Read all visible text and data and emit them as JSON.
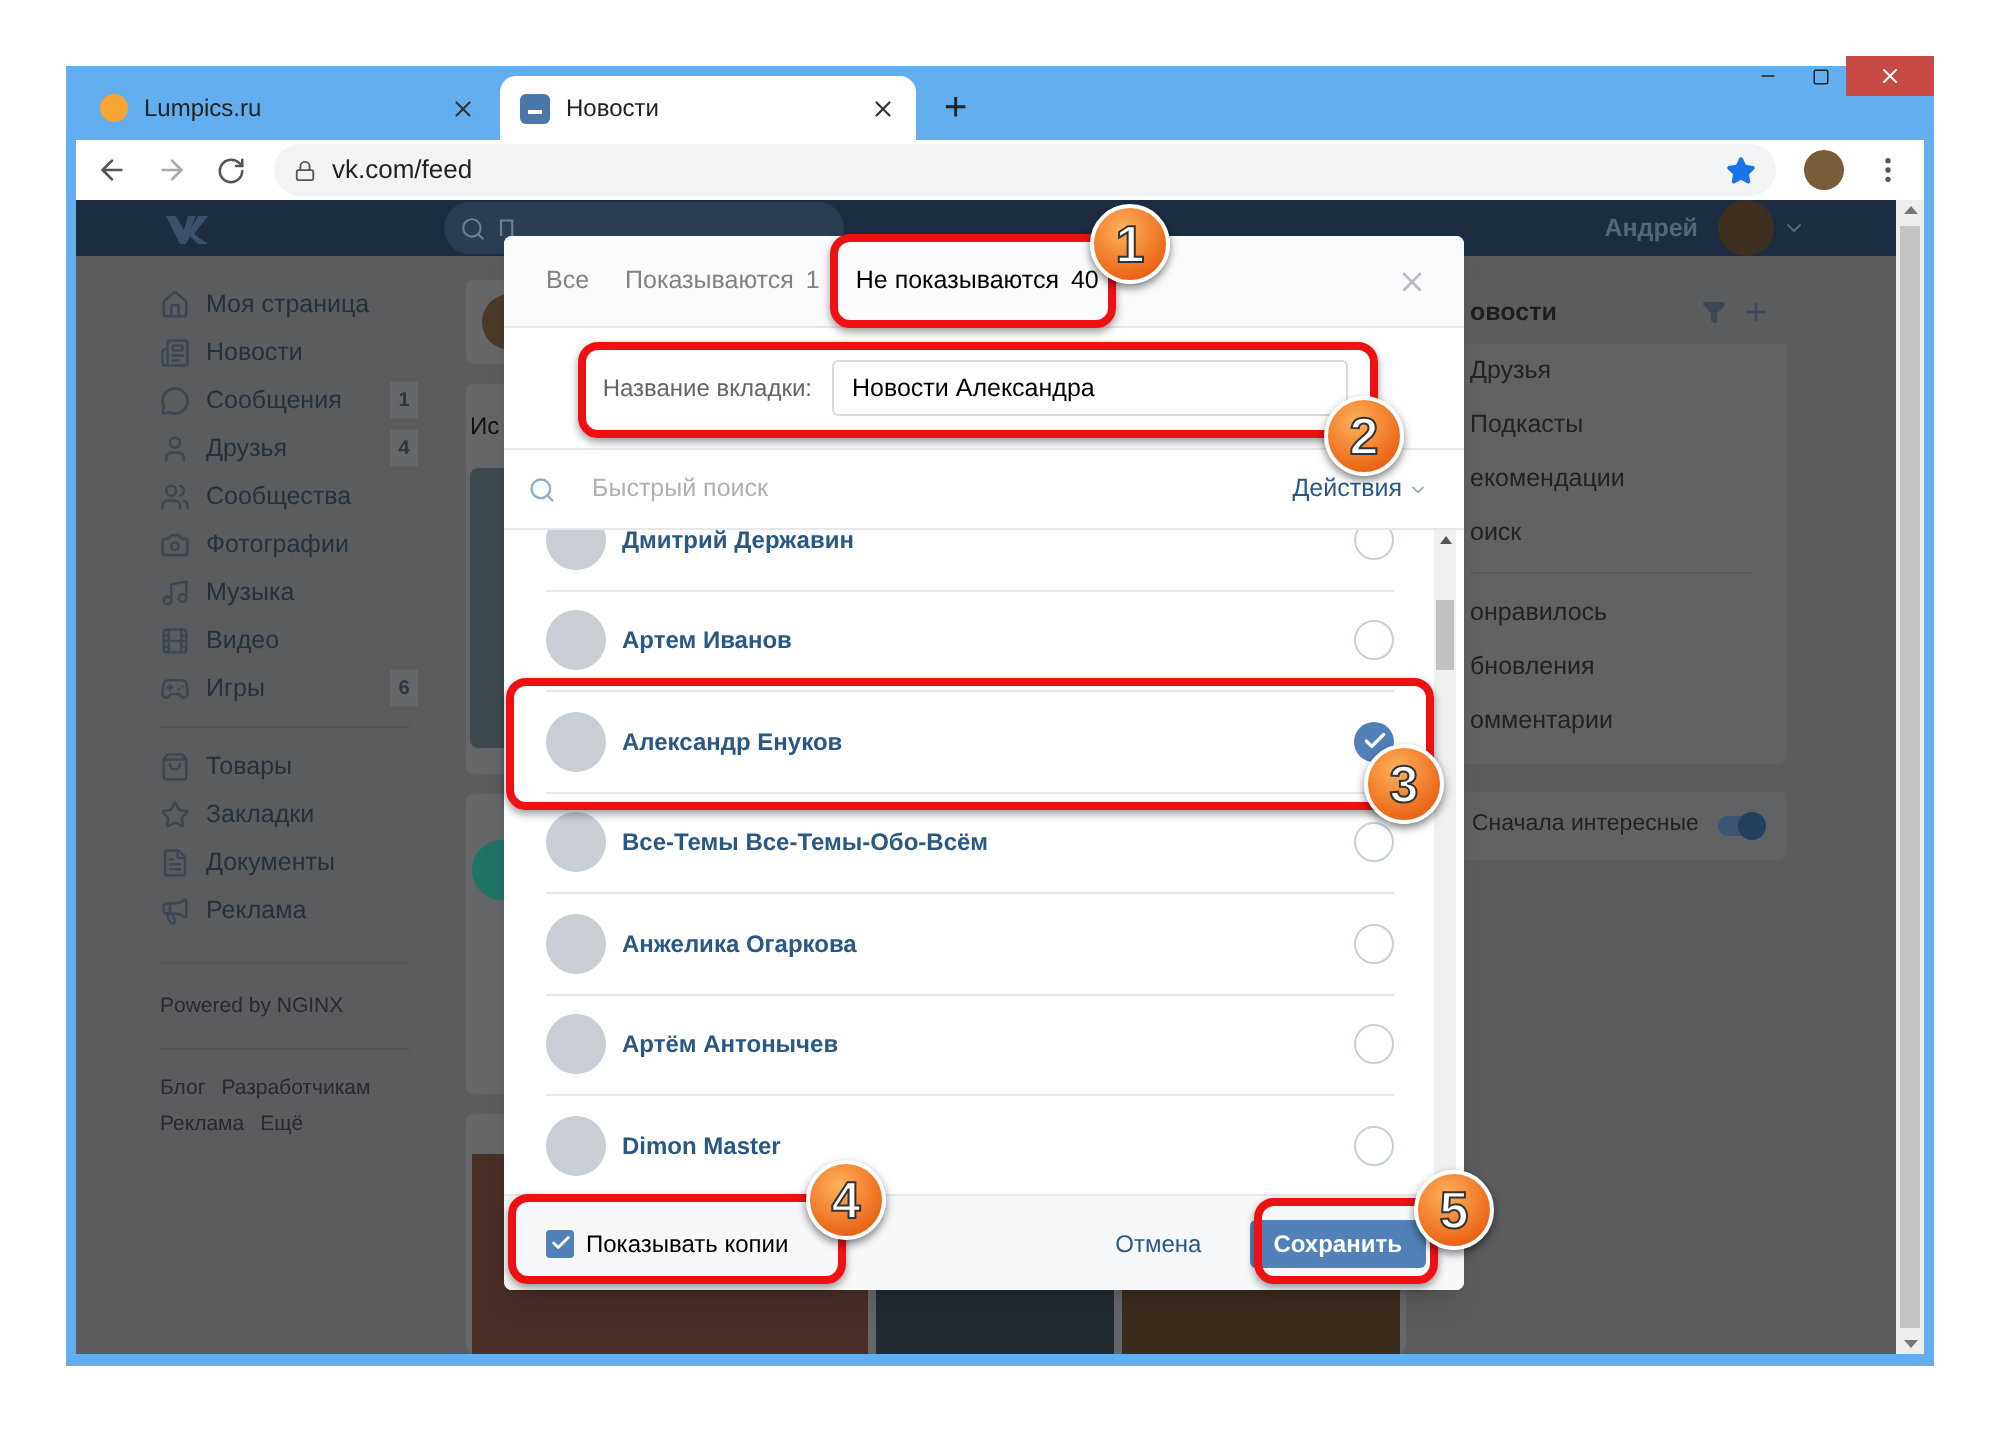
{
  "browser": {
    "tabs": [
      {
        "title": "Lumpics.ru",
        "selected": false
      },
      {
        "title": "Новости",
        "selected": true
      }
    ],
    "new_tab": "+",
    "address": "vk.com/feed"
  },
  "header": {
    "search_placeholder": "П",
    "user": "Андрей"
  },
  "sidebar": {
    "main_items": [
      {
        "label": "Моя страница"
      },
      {
        "label": "Новости"
      },
      {
        "label": "Сообщения",
        "count": "1"
      },
      {
        "label": "Друзья",
        "count": "4"
      },
      {
        "label": "Сообщества"
      },
      {
        "label": "Фотографии"
      },
      {
        "label": "Музыка"
      },
      {
        "label": "Видео"
      },
      {
        "label": "Игры",
        "count": "6"
      }
    ],
    "extra_items": [
      {
        "label": "Товары"
      },
      {
        "label": "Закладки"
      },
      {
        "label": "Документы"
      },
      {
        "label": "Реклама"
      }
    ],
    "powered": "Powered by NGINX",
    "links": [
      "Блог",
      "Разработчикам",
      "Реклама",
      "Ещё"
    ]
  },
  "feed": {
    "story_title": "Ис"
  },
  "right_menu": {
    "title": "овости",
    "items": [
      "Друзья",
      "Подкасты",
      "екомендации",
      "оиск"
    ],
    "items2": [
      "онравилось",
      "бновления",
      "омментарии"
    ],
    "toggle": {
      "label": "Сначала интересные",
      "on": true
    }
  },
  "modal": {
    "tabs": [
      {
        "label": "Все",
        "selected": false
      },
      {
        "label": "Показываются",
        "count": "1",
        "selected": false
      },
      {
        "label": "Не показываются",
        "count": "40",
        "selected": true
      }
    ],
    "field_label": "Название вкладки:",
    "field_value": "Новости Александра",
    "search_placeholder": "Быстрый поиск",
    "actions": "Действия",
    "people": [
      {
        "name": "Дмитрий Державин",
        "checked": false
      },
      {
        "name": "Артем Иванов",
        "checked": false
      },
      {
        "name": "Александр Енуков",
        "checked": true
      },
      {
        "name": "Все-Темы Все-Темы-Обо-Всём",
        "checked": false
      },
      {
        "name": "Анжелика Огаркова",
        "checked": false
      },
      {
        "name": "Артём Антонычев",
        "checked": false
      },
      {
        "name": "Dimon Master",
        "checked": false
      }
    ],
    "show_copies": {
      "label": "Показывать копии",
      "checked": true
    },
    "cancel": "Отмена",
    "save": "Сохранить"
  },
  "annotations": [
    "1",
    "2",
    "3",
    "4",
    "5"
  ]
}
